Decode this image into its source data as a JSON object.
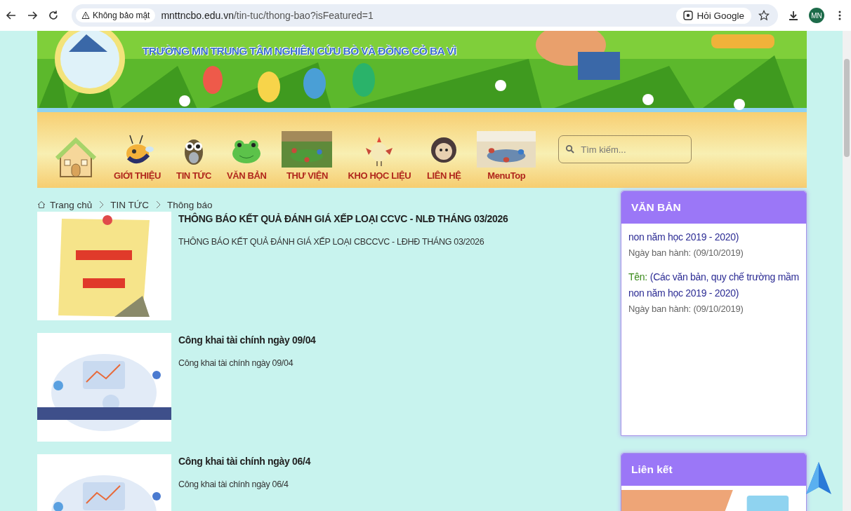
{
  "browser": {
    "security": "Không bảo mật",
    "url_host": "mnttncbo.edu.vn",
    "url_path": "/tin-tuc/thong-bao?isFeatured=1",
    "ask_google": "Hỏi Google",
    "avatar": "MN"
  },
  "header": {
    "title": "TRƯỜNG MN TRUNG TÂM NGHIÊN CỨU BÒ VÀ ĐỒNG CỎ BA VÌ"
  },
  "nav": {
    "items": [
      {
        "label": "GIỚI THIỆU",
        "kind": "icon"
      },
      {
        "label": "TIN TỨC",
        "kind": "icon"
      },
      {
        "label": "VĂN BẢN",
        "kind": "icon"
      },
      {
        "label": "THƯ VIỆN"
      },
      {
        "label": "KHO HỌC LIỆU",
        "kind": "icon"
      },
      {
        "label": "LIÊN HỆ",
        "kind": "icon"
      },
      {
        "label": "MenuTop"
      }
    ],
    "search": {
      "placeholder": "Tìm kiếm..."
    }
  },
  "breadcrumb": [
    "Trang chủ",
    "TIN TỨC",
    "Thông báo"
  ],
  "articles": [
    {
      "title": "THÔNG BÁO KẾT QUẢ ĐÁNH GIÁ XẾP LOẠI CCVC - NLĐ THÁNG 03/2026",
      "summary": "THÔNG BÁO KẾT QUẢ ĐÁNH GIÁ XẾP LOẠI CBCCVC - LĐHĐ THÁNG 03/2026"
    },
    {
      "title": "Công khai tài chính ngày 09/04",
      "summary": "Công khai tài chính ngày 09/04"
    },
    {
      "title": "Công khai tài chính ngày 06/4",
      "summary": "Công khai tài chính ngày 06/4"
    }
  ],
  "sidebar": {
    "documents": {
      "heading": "VĂN BẢN",
      "items": [
        {
          "name": "non năm học 2019 - 2020)",
          "date": "Ngày ban hành: (09/10/2019)"
        },
        {
          "label": "Tên:",
          "name": "(Các văn bản, quy chế trường mầm non năm học 2019 - 2020)",
          "date": "Ngày ban hành: (09/10/2019)"
        }
      ]
    },
    "links": {
      "heading": "Liên kết"
    }
  }
}
